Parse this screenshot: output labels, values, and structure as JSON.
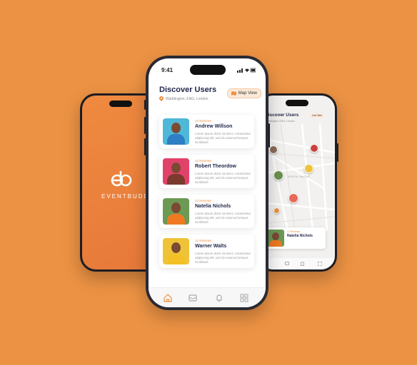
{
  "splash": {
    "brand": "EVENTBUDDY"
  },
  "main": {
    "status_time": "9:41",
    "title": "Discover Users",
    "location": "Waddington, ENG, London",
    "map_view_label": "Map View",
    "users": [
      {
        "reviews": "12 Reviews",
        "name": "Andrew Willson",
        "desc": "Lorem ipsum dolor sit amet, consectetur adipiscing elit, sed do eiusmod tempor incididunt",
        "bg": "#4fb8d8",
        "shirt": "#2f7fc4"
      },
      {
        "reviews": "12 Reviews",
        "name": "Robert Theordow",
        "desc": "Lorem ipsum dolor sit amet, consectetur adipiscing elit, sed do eiusmod tempor incididunt",
        "bg": "#e0426a",
        "shirt": "#7a3a2e"
      },
      {
        "reviews": "12 Reviews",
        "name": "Natelia Nichols",
        "desc": "Lorem ipsum dolor sit amet, consectetur adipiscing elit, sed do eiusmod tempor incididunt",
        "bg": "#6c9a55",
        "shirt": "#f07a22"
      },
      {
        "reviews": "12 Reviews",
        "name": "Warner Walts",
        "desc": "Lorem ipsum dolor sit amet, consectetur adipiscing elit, sed do eiusmod tempor incididunt",
        "bg": "#efc338",
        "shirt": "#f3c126"
      }
    ],
    "tabs": [
      "home-icon",
      "inbox-icon",
      "bell-icon",
      "grid-icon"
    ]
  },
  "map": {
    "title": "Discover Users",
    "location": "Waddington, ENG, London",
    "list_view_label": "List View",
    "area_label": "ASHOK NAGAR",
    "card_reviews": "12 Reviews",
    "card_name": "Natelia Nichols"
  },
  "colors": {
    "accent": "#EC9244",
    "navy": "#1f2549"
  }
}
